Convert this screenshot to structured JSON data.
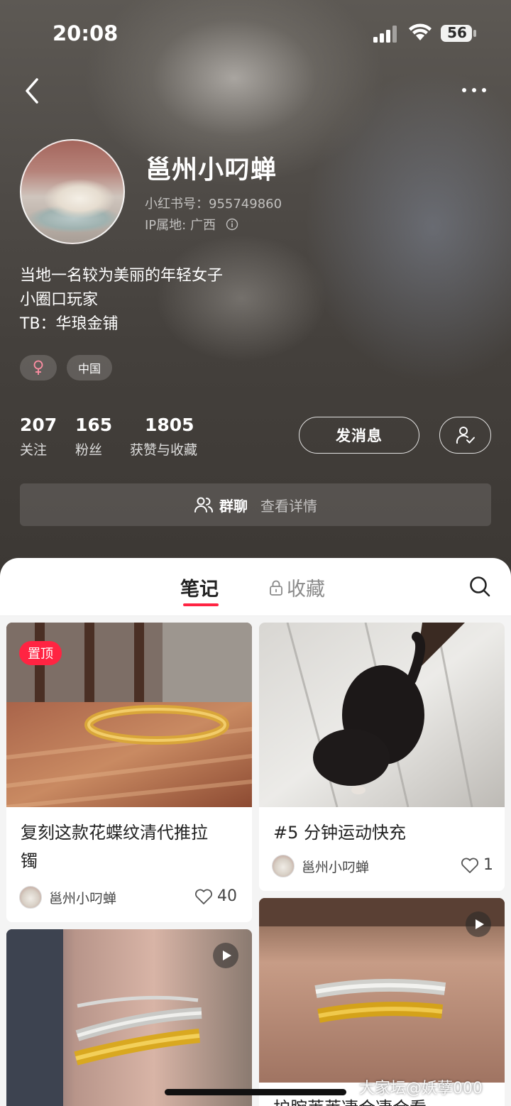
{
  "status_bar": {
    "time": "20:08",
    "battery": "56"
  },
  "profile": {
    "name": "邕州小叼蝉",
    "red_id": "小红书号：955749860",
    "ip_location": "IP属地: 广西",
    "bio": [
      "当地一名较为美丽的年轻女子",
      "小圈口玩家",
      "TB：华琅金铺"
    ],
    "tags": {
      "gender_symbol": "♀",
      "region": "中国"
    },
    "stats": [
      {
        "value": "207",
        "label": "关注"
      },
      {
        "value": "165",
        "label": "粉丝"
      },
      {
        "value": "1805",
        "label": "获赞与收藏"
      }
    ],
    "message_button": "发消息",
    "group_chat": {
      "label": "群聊",
      "link": "查看详情"
    }
  },
  "tabs": {
    "notes": "笔记",
    "collections": "收藏"
  },
  "notes": [
    {
      "pinned_label": "置顶",
      "title_line1": "复刻这款花蝶纹清代推拉",
      "title_line2": "镯",
      "author": "邕州小叼蝉",
      "likes": "40"
    },
    {
      "title": "#5 分钟运动快充",
      "author": "邕州小叼蝉",
      "likes": "1"
    },
    {
      "type": "video"
    },
    {
      "type": "video",
      "title_partial": "护腕莱莱凄合凄合看"
    }
  ],
  "watermark": "大家坛@妖孽000",
  "colors": {
    "accent": "#ff2442",
    "header_bg": "#48443f"
  }
}
